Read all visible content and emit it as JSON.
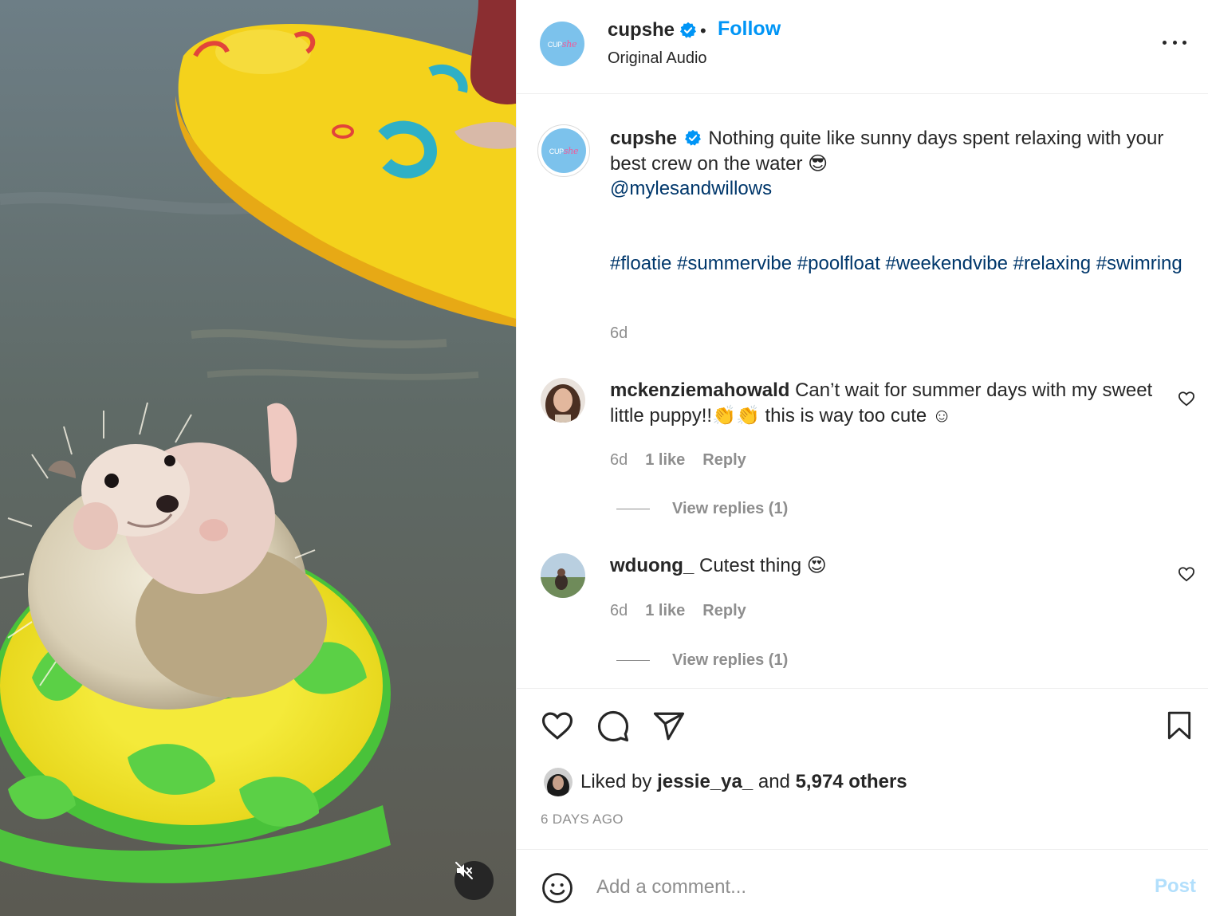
{
  "post": {
    "username": "cupshe",
    "follow_label": "Follow",
    "separator": "•",
    "audio": "Original Audio",
    "brand_logo_a": "CUP",
    "brand_logo_b": "she"
  },
  "caption": {
    "username": "cupshe",
    "text": "Nothing quite like sunny days spent relaxing with your best crew on the water 😎",
    "mention": "@mylesandwillows",
    "hashtags": "#floatie #summervibe #poolfloat #weekendvibe #relaxing #swimring",
    "time": "6d"
  },
  "comments": [
    {
      "username": "mckenziemahowald",
      "text": "Can’t wait for summer days with my sweet little puppy!!👏👏 this is way too cute ☺",
      "time": "6d",
      "likes": "1 like",
      "reply": "Reply",
      "view_replies": "View replies (1)"
    },
    {
      "username": "wduong_",
      "text": "Cutest thing 😍",
      "time": "6d",
      "likes": "1 like",
      "reply": "Reply",
      "view_replies": "View replies (1)"
    }
  ],
  "liked": {
    "prefix": "Liked by",
    "user": "jessie_ya_",
    "joiner": "and",
    "others": "5,974 others"
  },
  "timestamp": "6 DAYS AGO",
  "add_comment": {
    "placeholder": "Add a comment...",
    "post_label": "Post"
  },
  "icons": {
    "verified": "verified-badge-icon",
    "more": "more-options-icon",
    "like": "heart-icon",
    "comment": "comment-icon",
    "share": "share-icon",
    "save": "bookmark-icon",
    "emoji": "emoji-icon",
    "mute": "muted-speaker-icon"
  },
  "colors": {
    "accent": "#0095f6",
    "link": "#00376b",
    "muted_text": "#8e8e8e",
    "post_disabled": "#b2dffc"
  }
}
